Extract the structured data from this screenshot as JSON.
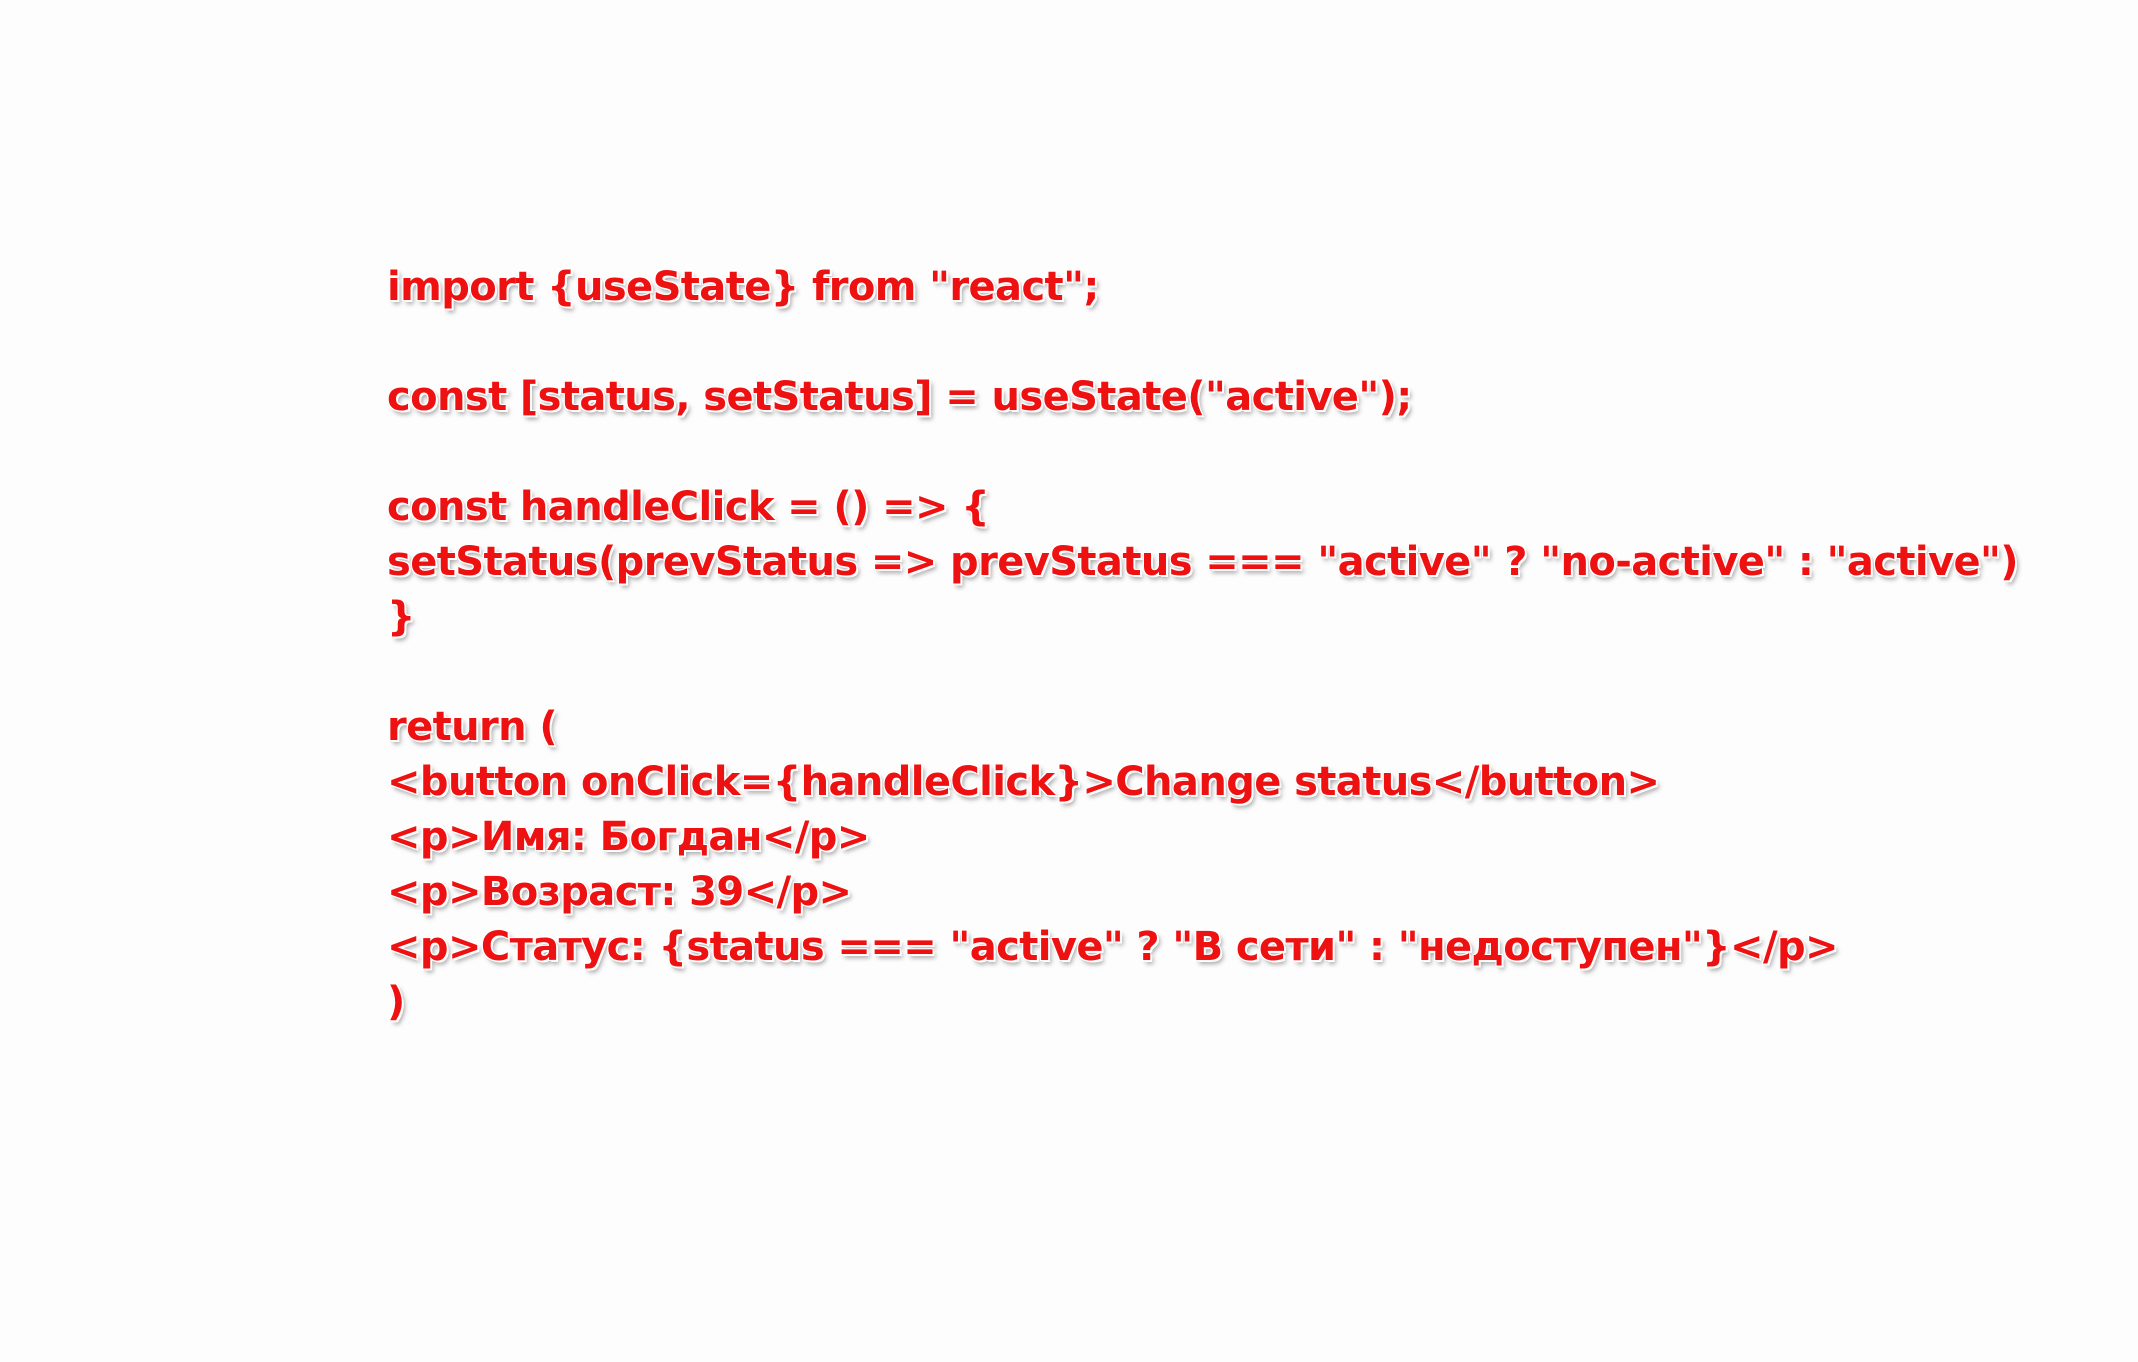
{
  "code": {
    "lines": [
      "import {useState} from \"react\";",
      "",
      "const [status, setStatus] = useState(\"active\");",
      "",
      "const handleClick = () => {",
      "setStatus(prevStatus => prevStatus === \"active\" ? \"no-active\" : \"active\")",
      "}",
      "",
      "return (",
      "<button onClick={handleClick}>Change status</button>",
      "<p>Имя: Богдан</p>",
      "<p>Возраст: 39</p>",
      "<p>Статус: {status === \"active\" ? \"В сети\" : \"недоступен\"}</p>",
      ")"
    ]
  },
  "colors": {
    "text": "#ee1111",
    "background": "#fdfdfd",
    "outline": "#ffffff"
  }
}
